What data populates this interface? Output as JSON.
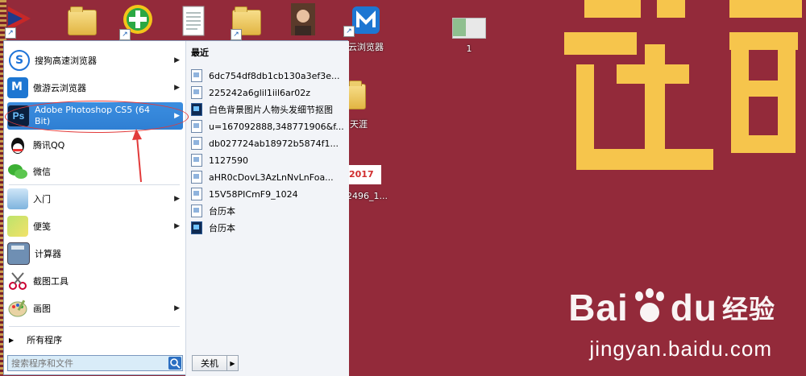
{
  "desktop": {
    "icons": [
      {
        "label": "",
        "kind": "app-arrow"
      },
      {
        "label": "",
        "kind": "folder"
      },
      {
        "label": "",
        "kind": "360-plus"
      },
      {
        "label": "",
        "kind": "document"
      },
      {
        "label": "",
        "kind": "folder-files"
      },
      {
        "label": "",
        "kind": "photo"
      },
      {
        "label": "云浏览器",
        "kind": "maxthon"
      },
      {
        "label": "1",
        "kind": "image-file"
      },
      {
        "label": "天涯",
        "kind": "folder"
      },
      {
        "label": "2496_1...",
        "kind": "image-2017"
      }
    ],
    "wallpaper": {
      "big_text": "过",
      "year_badge": "2017",
      "watermark_brand": "Bai",
      "watermark_brand_tail": "du",
      "watermark_cn": "经验",
      "watermark_url": "jingyan.baidu.com"
    }
  },
  "start_menu": {
    "programs": [
      {
        "label": "搜狗高速浏览器",
        "has_submenu": true,
        "icon": "sogou-icon"
      },
      {
        "label": "傲游云浏览器",
        "has_submenu": true,
        "icon": "maxthon-icon"
      },
      {
        "label": "Adobe Photoshop CS5 (64 Bit)",
        "has_submenu": true,
        "icon": "photoshop-icon",
        "selected": true,
        "icon_text": "Ps"
      },
      {
        "label": "腾讯QQ",
        "has_submenu": false,
        "icon": "qq-icon"
      },
      {
        "label": "微信",
        "has_submenu": false,
        "icon": "wechat-icon"
      },
      {
        "label": "入门",
        "has_submenu": true,
        "icon": "getting-started-icon"
      },
      {
        "label": "便笺",
        "has_submenu": true,
        "icon": "sticky-notes-icon"
      },
      {
        "label": "计算器",
        "has_submenu": false,
        "icon": "calculator-icon"
      },
      {
        "label": "截图工具",
        "has_submenu": false,
        "icon": "snipping-tool-icon"
      },
      {
        "label": "画图",
        "has_submenu": true,
        "icon": "paint-icon"
      }
    ],
    "all_programs_label": "所有程序",
    "search_placeholder": "搜索程序和文件",
    "shutdown_label": "关机",
    "recent": {
      "title": "最近",
      "items": [
        {
          "label": "6dc754df8db1cb130a3ef3e...",
          "type": "doc"
        },
        {
          "label": "225242a6glil1iil6ar02z",
          "type": "doc"
        },
        {
          "label": "白色背景图片人物头发细节抠图",
          "type": "ps"
        },
        {
          "label": "u=167092888,348771906&f...",
          "type": "doc"
        },
        {
          "label": "db027724ab18972b5874f1...",
          "type": "doc"
        },
        {
          "label": "1127590",
          "type": "doc"
        },
        {
          "label": "aHR0cDovL3AzLnNvLnFoa...",
          "type": "doc"
        },
        {
          "label": "15V58PICmF9_1024",
          "type": "doc"
        },
        {
          "label": "台历本",
          "type": "doc"
        },
        {
          "label": "台历本",
          "type": "ps"
        }
      ]
    }
  }
}
